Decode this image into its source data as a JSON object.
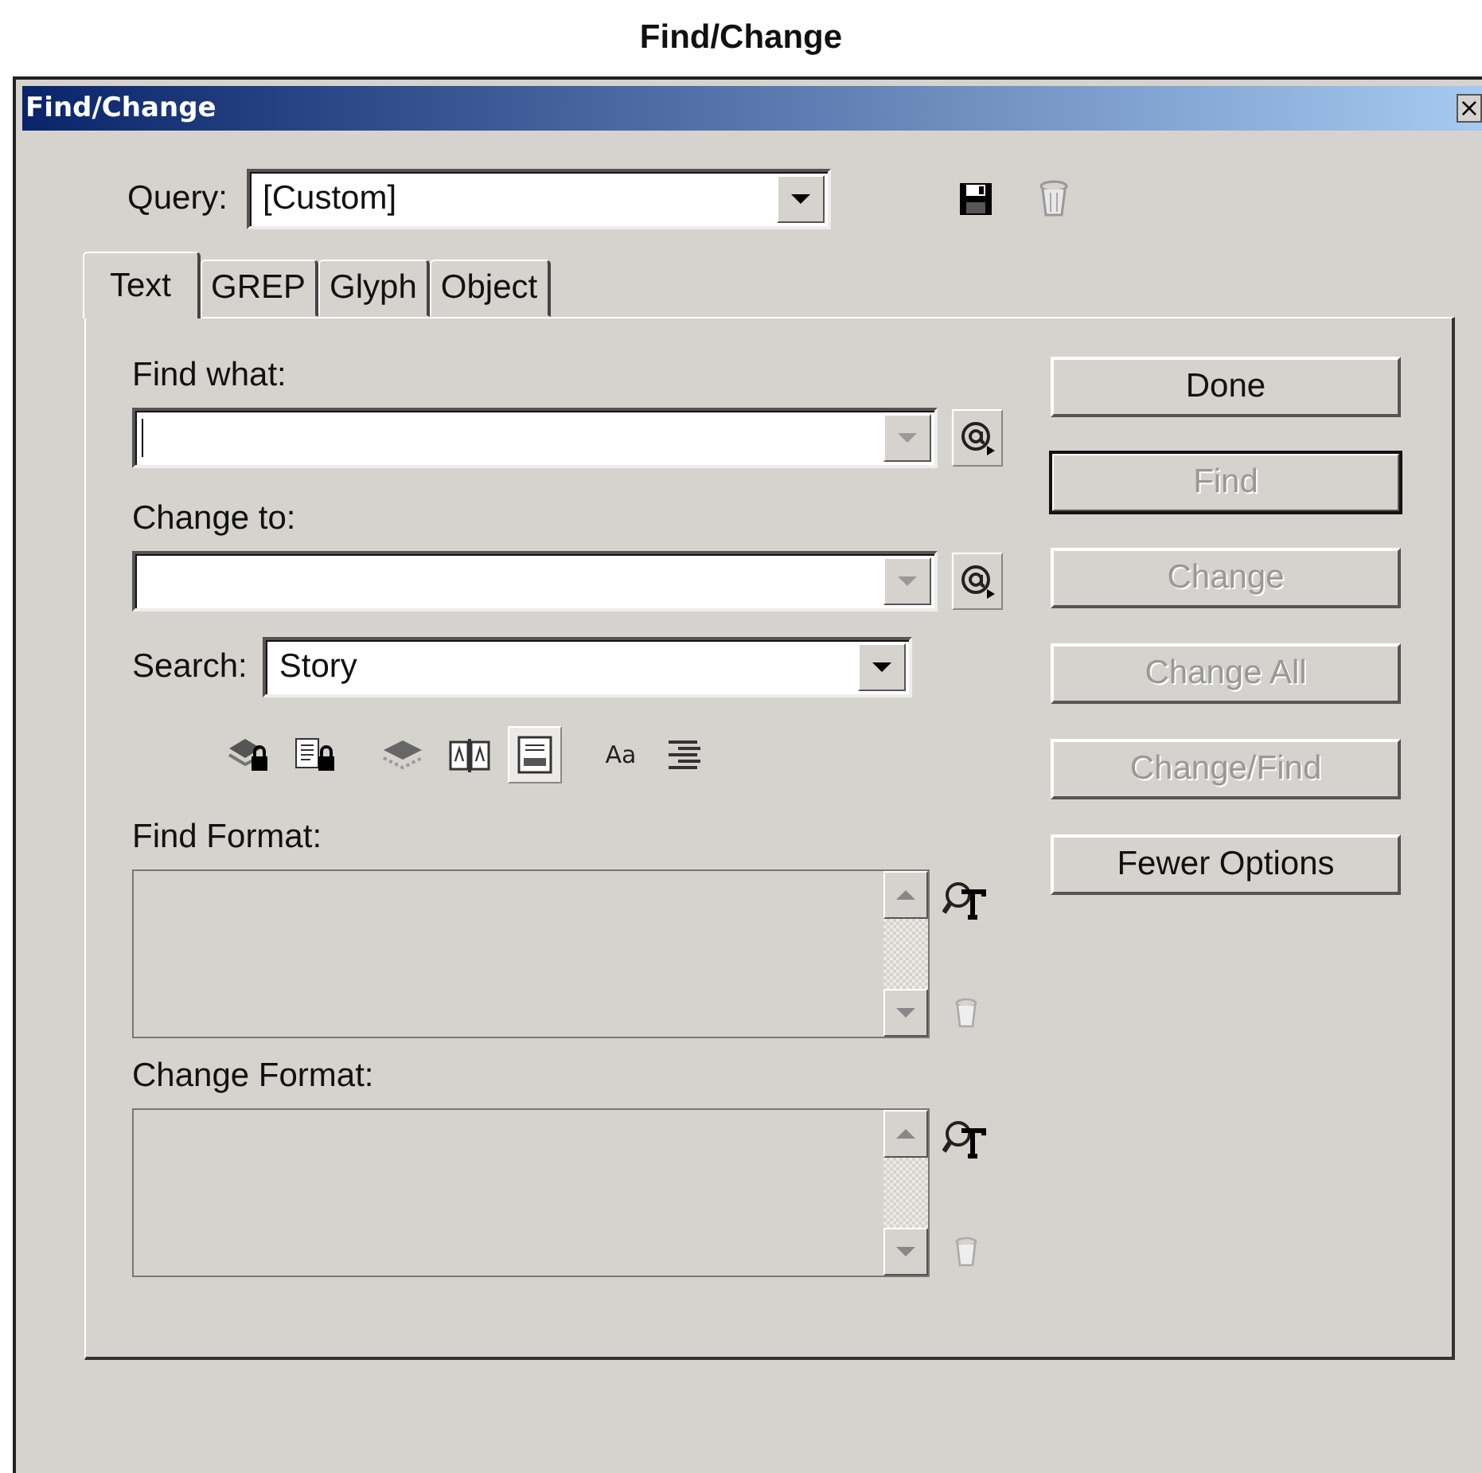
{
  "caption": "Find/Change",
  "window": {
    "title": "Find/Change",
    "close": "×"
  },
  "query": {
    "label": "Query:",
    "value": "[Custom]"
  },
  "tabs": [
    {
      "label": "Text",
      "selected": true
    },
    {
      "label": "GREP",
      "selected": false
    },
    {
      "label": "Glyph",
      "selected": false
    },
    {
      "label": "Object",
      "selected": false
    }
  ],
  "find_what": {
    "label": "Find what:",
    "focused": true
  },
  "change_to": {
    "label": "Change to:",
    "focused": false
  },
  "search": {
    "label": "Search:",
    "value": "Story"
  },
  "options": [
    {
      "kind": "layers-lock",
      "selected": false
    },
    {
      "kind": "page-lock",
      "selected": false
    },
    {
      "kind": "layers",
      "selected": false
    },
    {
      "kind": "book",
      "selected": false
    },
    {
      "kind": "note",
      "selected": true
    },
    {
      "kind": "text",
      "label": "Aa",
      "selected": false
    },
    {
      "kind": "lines",
      "selected": false
    }
  ],
  "formats": [
    {
      "label": "Find Format:"
    },
    {
      "label": "Change Format:"
    }
  ],
  "buttons": [
    {
      "label": "Done",
      "disabled": false,
      "default": false
    },
    {
      "label": "Find",
      "disabled": true,
      "default": true
    },
    {
      "label": "Change",
      "disabled": true,
      "default": false
    },
    {
      "label": "Change All",
      "disabled": true,
      "default": false
    },
    {
      "label": "Change/Find",
      "disabled": true,
      "default": false
    },
    {
      "label": "Fewer Options",
      "disabled": false,
      "default": false
    }
  ]
}
